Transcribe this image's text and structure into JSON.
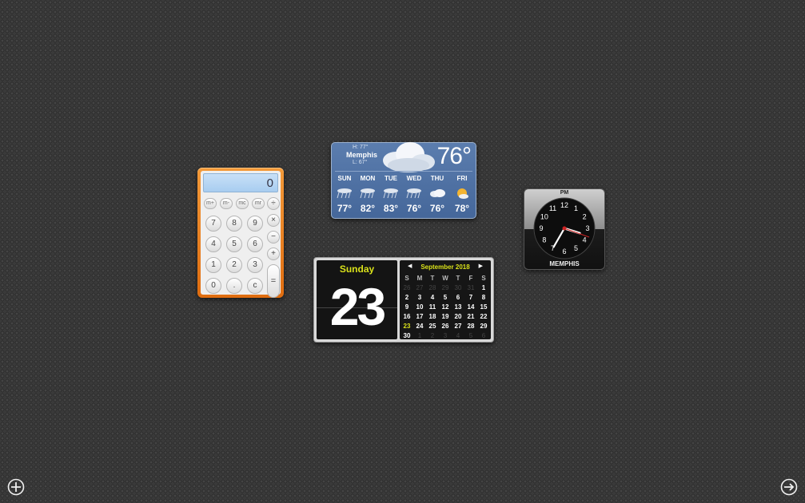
{
  "calculator": {
    "display": "0",
    "memory_keys": [
      "m+",
      "m-",
      "mc",
      "mr"
    ],
    "divide": "÷",
    "multiply": "×",
    "minus": "−",
    "plus": "+",
    "equals": "=",
    "rows": [
      [
        "7",
        "8",
        "9"
      ],
      [
        "4",
        "5",
        "6"
      ],
      [
        "1",
        "2",
        "3"
      ],
      [
        "0",
        ".",
        "c"
      ]
    ]
  },
  "weather": {
    "high": "H: 77°",
    "city": "Memphis",
    "low": "L: 67°",
    "current_temp": "76°",
    "days": [
      "SUN",
      "MON",
      "TUE",
      "WED",
      "THU",
      "FRI"
    ],
    "highs": [
      "77°",
      "82°",
      "83°",
      "76°",
      "76°",
      "78°"
    ],
    "icons": [
      "storm-icon",
      "storm-icon",
      "storm-icon",
      "storm-icon",
      "cloudy-icon",
      "partly-sunny-icon"
    ]
  },
  "clock": {
    "period": "PM",
    "city": "MEMPHIS",
    "numerals": [
      "12",
      "1",
      "2",
      "3",
      "4",
      "5",
      "6",
      "7",
      "8",
      "9",
      "10",
      "11"
    ],
    "hour_hand_time": "3:35",
    "accent_color": "#cc2222"
  },
  "calendar": {
    "weekday": "Sunday",
    "day": "23",
    "month_label": "September 2018",
    "weekday_headers": [
      "S",
      "M",
      "T",
      "W",
      "T",
      "F",
      "S"
    ],
    "weeks": [
      [
        "26",
        "27",
        "28",
        "29",
        "30",
        "31",
        "1"
      ],
      [
        "2",
        "3",
        "4",
        "5",
        "6",
        "7",
        "8"
      ],
      [
        "9",
        "10",
        "11",
        "12",
        "13",
        "14",
        "15"
      ],
      [
        "16",
        "17",
        "18",
        "19",
        "20",
        "21",
        "22"
      ],
      [
        "23",
        "24",
        "25",
        "26",
        "27",
        "28",
        "29"
      ],
      [
        "30",
        "1",
        "2",
        "3",
        "4",
        "5",
        "6"
      ]
    ],
    "accent_color": "#d9e11a"
  },
  "controls": {
    "add_icon": "plus-circle-icon",
    "exit_icon": "arrow-right-circle-icon"
  }
}
